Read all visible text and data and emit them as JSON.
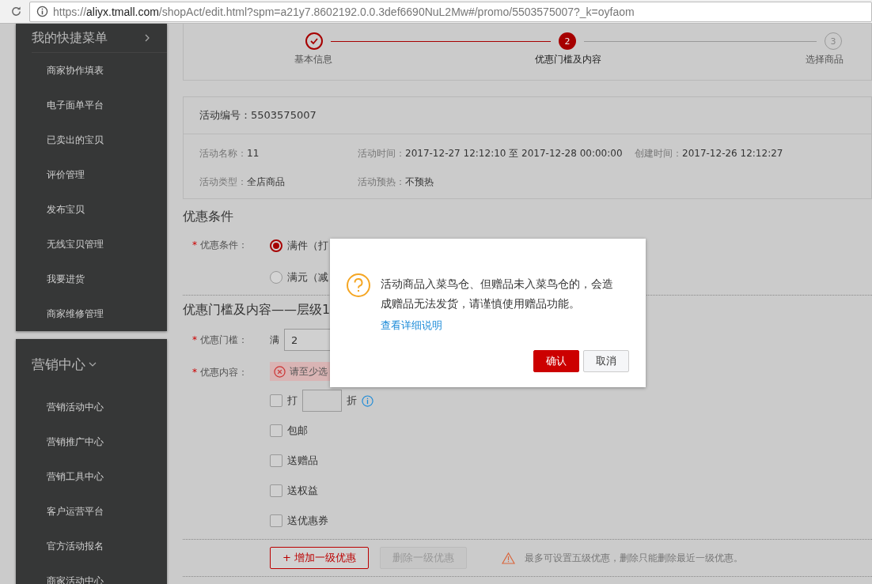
{
  "address_bar": {
    "scheme": "https://",
    "host": "aliyx.tmall.com",
    "path": "/shopAct/edit.html?spm=a21y7.8602192.0.0.3def6690NuL2Mw#/promo/5503575007?_k=oyfaom"
  },
  "sidebar": [
    {
      "title": "我的快捷菜单",
      "expanded": false,
      "items": [
        "商家协作填表",
        "电子面单平台",
        "已卖出的宝贝",
        "评价管理",
        "发布宝贝",
        "无线宝贝管理",
        "我要进货",
        "商家维修管理"
      ]
    },
    {
      "title": "营销中心",
      "expanded": true,
      "items": [
        "营销活动中心",
        "营销推广中心",
        "营销工具中心",
        "客户运营平台",
        "官方活动报名",
        "商家活动中心"
      ]
    }
  ],
  "steps": [
    {
      "label": "基本信息",
      "completed": true,
      "selected": false
    },
    {
      "label": "优惠门槛及内容",
      "number": "2",
      "completed": false,
      "selected": true
    },
    {
      "label": "选择商品",
      "number": "3",
      "completed": false,
      "selected": false
    }
  ],
  "info": {
    "id_label": "活动编号：",
    "id_value": "5503575007",
    "fields": [
      {
        "label": "活动名称：",
        "value": "11"
      },
      {
        "label": "活动时间：",
        "value": "2017-12-27 12:12:10 至 2017-12-28 00:00:00"
      },
      {
        "label": "创建时间：",
        "value": "2017-12-26 12:12:27"
      },
      {
        "label": "活动类型：",
        "value": "全店商品"
      },
      {
        "label": "活动预热：",
        "value": "不预热"
      }
    ]
  },
  "condition_section": {
    "title": "优惠条件",
    "required_mark": "*",
    "label": "优惠条件：",
    "options": [
      {
        "label": "满件（打",
        "selected": true
      },
      {
        "label": "满元（减",
        "selected": false
      }
    ]
  },
  "level_section": {
    "title": "优惠门槛及内容——层级1",
    "threshold_mark": "*",
    "threshold_label": "优惠门槛：",
    "threshold_prefix": "满",
    "threshold_value": "2",
    "content_mark": "*",
    "content_label": "优惠内容：",
    "error": "请至少选",
    "options": [
      {
        "kind": "discount",
        "label": "打",
        "suffix": "折",
        "checked": false
      },
      {
        "kind": "plain",
        "label": "包邮",
        "checked": false
      },
      {
        "kind": "plain",
        "label": "送赠品",
        "checked": false
      },
      {
        "kind": "plain",
        "label": "送权益",
        "checked": false
      },
      {
        "kind": "plain",
        "label": "送优惠券",
        "checked": false
      }
    ]
  },
  "footer": {
    "add_button": "+ 增加一级优惠",
    "remove_button": "删除一级优惠",
    "remove_disabled": true,
    "notice": "最多可设置五级优惠，删除只能删除最近一级优惠。"
  },
  "dialog": {
    "message": "活动商品入菜鸟仓、但赠品未入菜鸟仓的，会造成赠品无法发货，请谨慎使用赠品功能。",
    "link": "查看详细说明",
    "buttons": [
      {
        "label": "确认",
        "kind": "primary"
      },
      {
        "label": "取消",
        "kind": "secondary"
      }
    ]
  }
}
